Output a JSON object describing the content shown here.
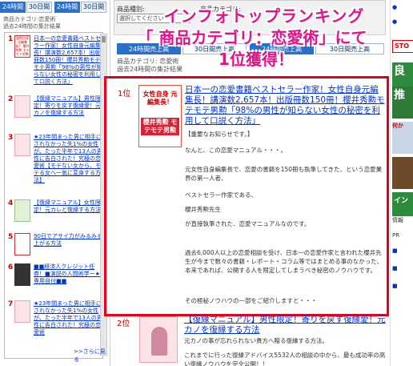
{
  "left": {
    "tabs": [
      "24時間",
      "30日間",
      "24時間",
      "30日間"
    ],
    "category_line1": "商品カテゴリ:恋愛術",
    "category_line2": "過去24時間の集計結果",
    "items": [
      {
        "rank": "1",
        "thumb_text": "女性自身 元編集長！ 櫻井秀勲 モテモテ男勲",
        "text": "日本一の恋愛書籍ベストセラー作家！女性自身元編集長！講演数2,657本！出版冊数150冊！櫻井秀勲モテモテ男勲「98%の男性が知らない女性の秘密を利用して口説く方法」"
      },
      {
        "rank": "2",
        "thumb_text": "",
        "text": "【復縁マニュアル】男性限定！寄りを戻す復縁愛！元カノを復縁する方法"
      },
      {
        "rank": "3",
        "thumb_text": "",
        "text": "★23年間まった男に相手にされなかった失1%の女性が、たった半年で13人の男性に告白された！究極の恋愛術【モテない女から、モテる女へ一気に変身する方法】"
      },
      {
        "rank": "4",
        "thumb_text": "",
        "text": "【復縁マニュアル】女性限定！元カレと復縁する方法"
      },
      {
        "rank": "5",
        "thumb_text": "",
        "text": "90日でアサイ力がみるみる上がる方法"
      },
      {
        "rank": "6",
        "thumb_text": "",
        "text": "■■経済人クレジット任券！■演説の人間術学ー★■専用自付■■"
      },
      {
        "rank": "7",
        "thumb_text": "",
        "text": "★23年間まった男に相手にされなかった失1%の女性が、たった半年で13人の男性に告白された！究極の恋愛術"
      }
    ],
    "more": ">>さらに見る"
  },
  "middle": {
    "label_genre": "商品種別:",
    "label_category": "商品カテゴリ:",
    "select_value": "選択してください",
    "banner_line1": "インフォトップランキング",
    "banner_line2": "「 商品カテゴリ：恋愛術」にて",
    "banner_line3": "1位獲得！",
    "tabs": [
      "24時間売上高",
      "30日間売上高",
      "24時間売上高",
      "30日間売上高"
    ],
    "category_line": "商品カテゴリ: 恋愛術",
    "category_sub": "過去24時間の集計結果",
    "entry1": {
      "rank": "1位",
      "book_top": "女性自身 元編集長！",
      "book_bottom": "櫻井秀勲 モテモテ男勲",
      "title": "日本一の恋愛書籍ベストセラー作家！女性自身元編集長！講演数2,657本！出版冊数150冊！櫻井秀勲モテモテ男勲「98%の男性が知らない女性の秘密を利用して口説く方法」",
      "p1": "【重要なお知らせです。】",
      "p2": "なんと、この恋愛マニュアル・・・。",
      "p3": "元女性自身編集長で、恋愛の書籍を150冊も執筆してきた、という恋愛業界の第一人者、",
      "p4": "ベストセラー作家である、",
      "p5": "櫻井秀勲先生",
      "p6": "が直接執筆された、恋愛マニュアルなのです。",
      "p7": "過去6,000人以上の恋愛相談を受け、日本一の恋愛作家と言われた櫻井先生が今まで数々の書籍・レポート・コラム等ではまとめる事のなかった、本来であれば、公開する人を限定してしまうべき秘密のノウハウです。",
      "p8": "その極秘ノウハウの一部をご紹介しますと・・・"
    },
    "entry2": {
      "rank": "2位",
      "title": "【復縁マニュアル】男性限定！寄りを戻す復縁愛！元カノを復縁する方法",
      "p1": "元カノの事が忘れられない貴方へ贈る復縁する方法。",
      "p2": "これまでに行った復縁アドバイス5532人の相談の中から、最も成功率の高い復縁ノウハウを完全公開！！"
    }
  },
  "right": {
    "items": [
      "●",
      "●",
      "STO",
      "良",
      "推",
      "何か",
      "イン",
      "情報",
      "PR",
      "■",
      "■",
      "■"
    ]
  },
  "colors": {
    "banner": "#e3128a",
    "frame": "#e6001a",
    "link": "#0033cc",
    "rank": "#cc0000"
  }
}
